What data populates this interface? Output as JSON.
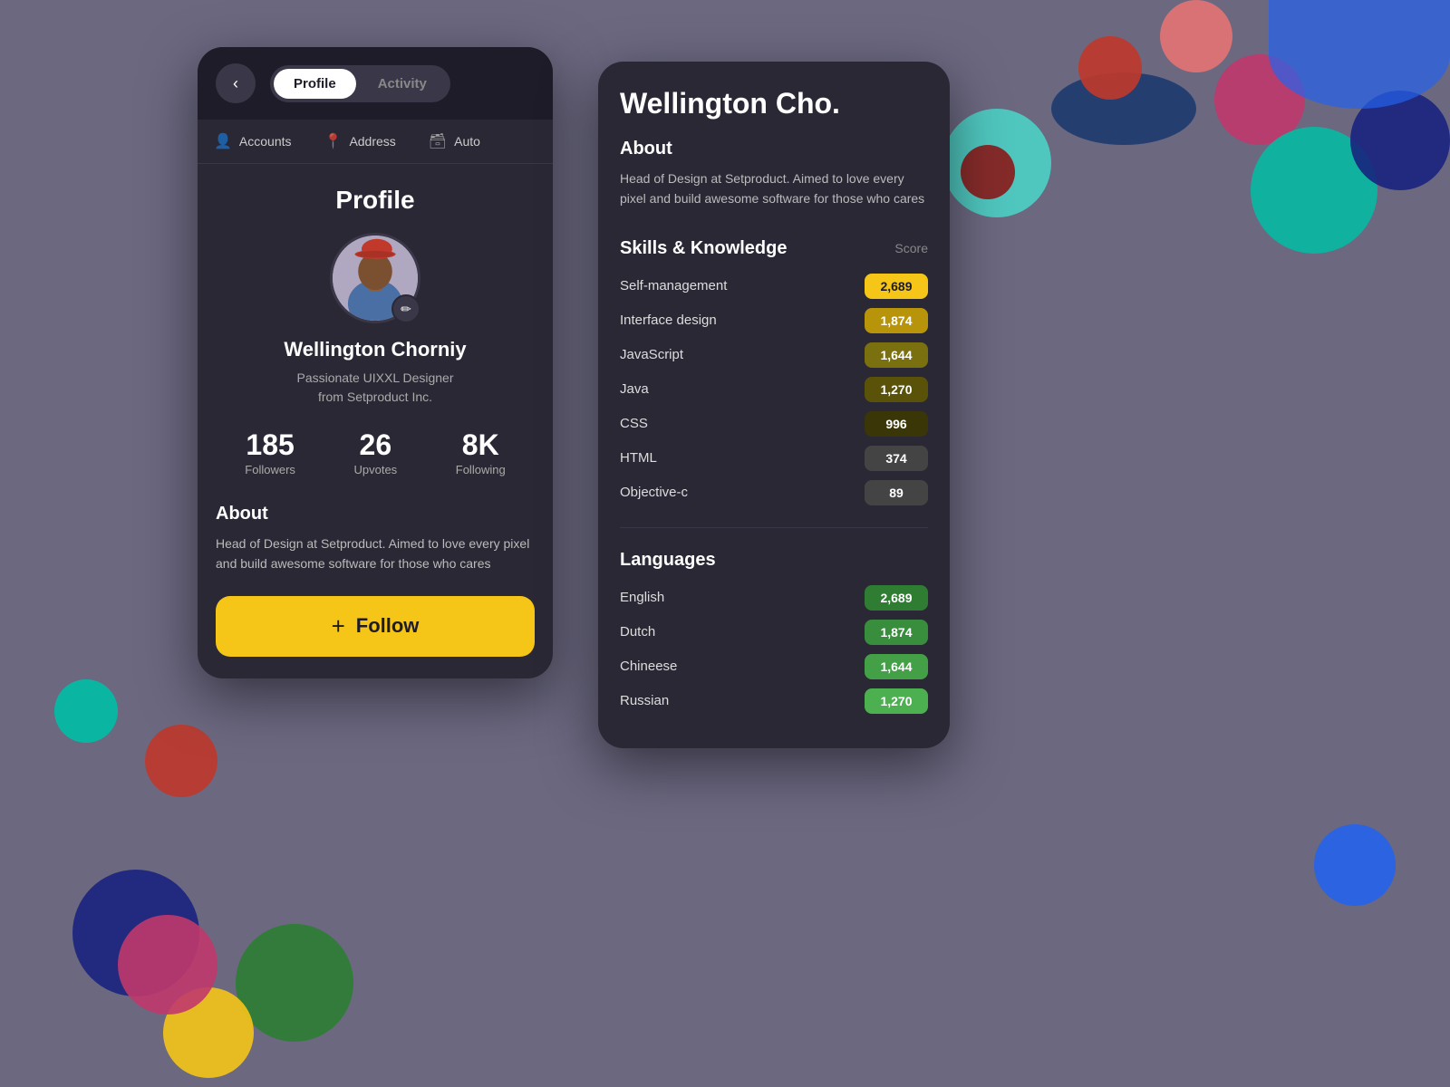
{
  "background": {
    "color": "#6b6880"
  },
  "header": {
    "back_label": "‹",
    "tabs": [
      {
        "id": "profile",
        "label": "Profile",
        "active": true
      },
      {
        "id": "activity",
        "label": "Activity",
        "active": false
      }
    ]
  },
  "subnav": {
    "items": [
      {
        "id": "accounts",
        "label": "Accounts",
        "icon": "👤"
      },
      {
        "id": "address",
        "label": "Address",
        "icon": "📍"
      },
      {
        "id": "auto",
        "label": "Auto",
        "icon": "🗄"
      }
    ]
  },
  "profile": {
    "title": "Profile",
    "name": "Wellington Chorniy",
    "bio": "Passionate UIXXL Designer\nfrom Setproduct Inc.",
    "stats": [
      {
        "value": "185",
        "label": "Followers"
      },
      {
        "value": "26",
        "label": "Upvotes"
      },
      {
        "value": "8K",
        "label": "Following"
      }
    ],
    "about_title": "About",
    "about_text": "Head of Design at Setproduct. Aimed to love every pixel and build awesome software for those who cares",
    "follow_label": "Follow"
  },
  "detail": {
    "name": "Wellington Cho.",
    "about_title": "About",
    "about_text": "Head of Design at Setproduct. Aimed to love every pixel and build awesome software for those who cares",
    "skills_title": "Skills & Knowledge",
    "score_label": "Score",
    "skills": [
      {
        "name": "Self-management",
        "score": "2,689",
        "badge_class": "badge-yellow"
      },
      {
        "name": "Interface design",
        "score": "1,874",
        "badge_class": "badge-dark-yellow"
      },
      {
        "name": "JavaScript",
        "score": "1,644",
        "badge_class": "badge-olive"
      },
      {
        "name": "Java",
        "score": "1,270",
        "badge_class": "badge-dark-olive"
      },
      {
        "name": "CSS",
        "score": "996",
        "badge_class": "badge-very-dark"
      },
      {
        "name": "HTML",
        "score": "374",
        "badge_class": "badge-gray"
      },
      {
        "name": "Objective-c",
        "score": "89",
        "badge_class": "badge-gray"
      }
    ],
    "languages_title": "Languages",
    "languages": [
      {
        "name": "English",
        "score": "2,689",
        "badge_class": "badge-green"
      },
      {
        "name": "Dutch",
        "score": "1,874",
        "badge_class": "badge-mid-green"
      },
      {
        "name": "Chineese",
        "score": "1,644",
        "badge_class": "badge-light-green"
      },
      {
        "name": "Russian",
        "score": "1,270",
        "badge_class": "badge-lighter-green"
      }
    ]
  }
}
